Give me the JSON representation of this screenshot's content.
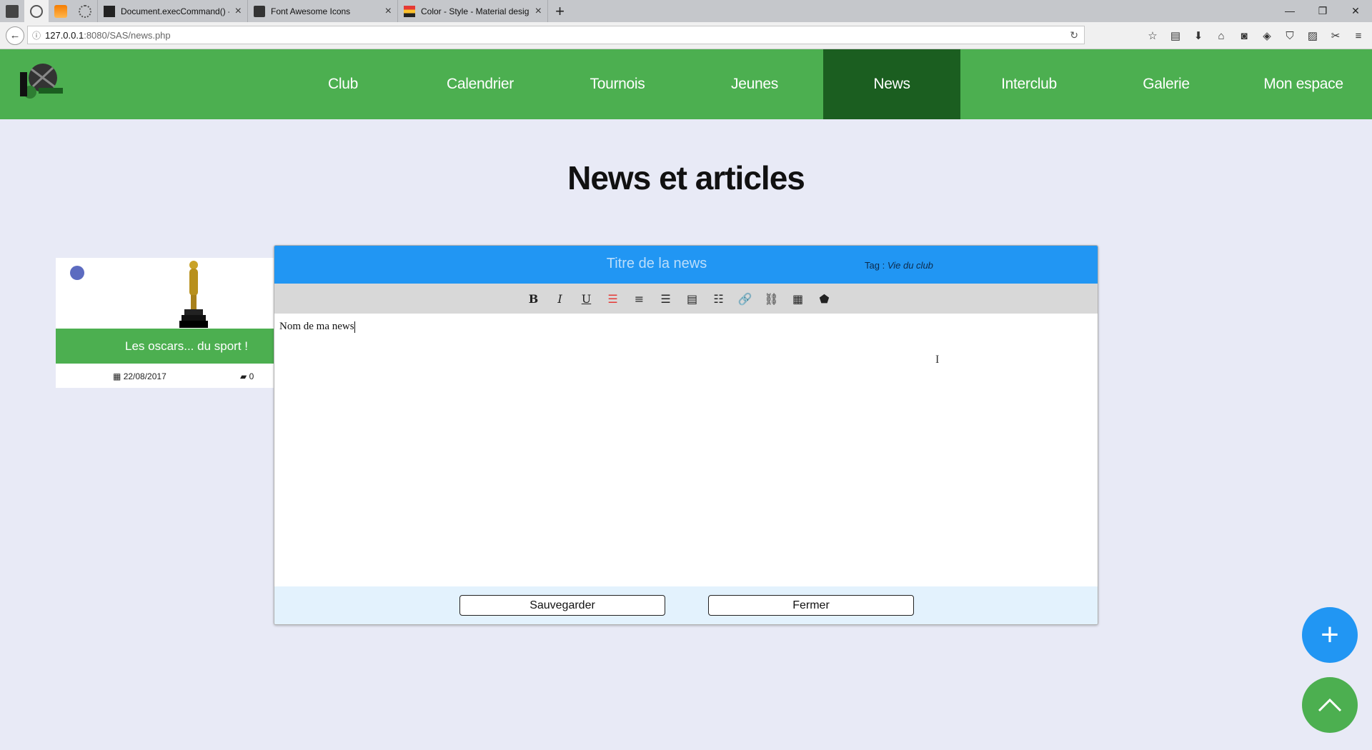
{
  "browser": {
    "tabs": [
      {
        "title": "Document.execCommand() -",
        "favicon": "mdn-icon"
      },
      {
        "title": "Font Awesome Icons",
        "favicon": "flag-icon"
      },
      {
        "title": "Color - Style - Material design",
        "favicon": "material-icon"
      }
    ],
    "url_host": "127.0.0.1",
    "url_rest": ":8080/SAS/news.php"
  },
  "site": {
    "nav": [
      "Club",
      "Calendrier",
      "Tournois",
      "Jeunes",
      "News",
      "Interclub",
      "Galerie",
      "Mon espace"
    ],
    "active": "News",
    "colors": {
      "primary": "#4caf50",
      "active": "#1b5e20",
      "accent": "#2196f3"
    }
  },
  "page": {
    "title": "News et articles"
  },
  "card": {
    "title": "Les oscars... du sport !",
    "date": "22/08/2017",
    "comments": "0"
  },
  "editor": {
    "title_placeholder": "Titre de la news",
    "tag_label": "Tag :",
    "tag_value": "Vie du club",
    "content": "Nom de ma news",
    "save_label": "Sauvegarder",
    "close_label": "Fermer"
  }
}
